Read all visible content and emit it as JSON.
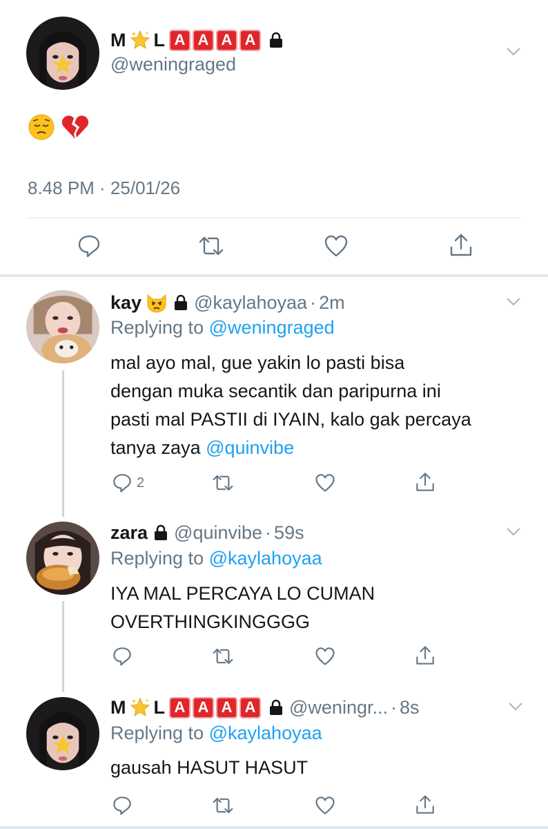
{
  "main_tweet": {
    "display_name": {
      "prefix": "M",
      "middle": "L",
      "badges": [
        "A",
        "A",
        "A",
        "A"
      ]
    },
    "handle": "@weningraged",
    "emoji_text": "😔💔",
    "timestamp": "8.48 PM · 25/01/26"
  },
  "replies": [
    {
      "name": "kay",
      "handle": "@kaylahoyaa",
      "time": "2m",
      "replying_label": "Replying to",
      "replying_to": "@weningraged",
      "lines": [
        "mal ayo mal, gue yakin lo pasti bisa",
        "dengan muka secantik dan paripurna ini",
        "pasti mal PASTII di IYAIN, kalo gak percaya"
      ],
      "last_line_text": "tanya zaya ",
      "last_line_mention": "@quinvibe",
      "reply_count": "2"
    },
    {
      "name": "zara",
      "handle": "@quinvibe",
      "time": "59s",
      "replying_label": "Replying to",
      "replying_to": "@kaylahoyaa",
      "lines": [
        "IYA MAL PERCAYA LO CUMAN",
        "OVERTHINGKINGGGG"
      ]
    },
    {
      "name_prefix": "M",
      "name_middle": "L",
      "badges": [
        "A",
        "A",
        "A",
        "A"
      ],
      "handle": "@weningr...",
      "time": "8s",
      "replying_label": "Replying to",
      "replying_to": "@kaylahoyaa",
      "lines": [
        "gausah HASUT HASUT"
      ]
    }
  ],
  "icons": [
    "reply-icon",
    "retweet-icon",
    "like-icon",
    "share-icon",
    "chevron-down-icon",
    "lock-icon",
    "star-emoji-icon",
    "pouting-cat-emoji-icon"
  ],
  "colors": {
    "link": "#1da1f2",
    "secondary": "#657786",
    "badge_red": "#e0262b",
    "divider": "#e1e8ed"
  }
}
